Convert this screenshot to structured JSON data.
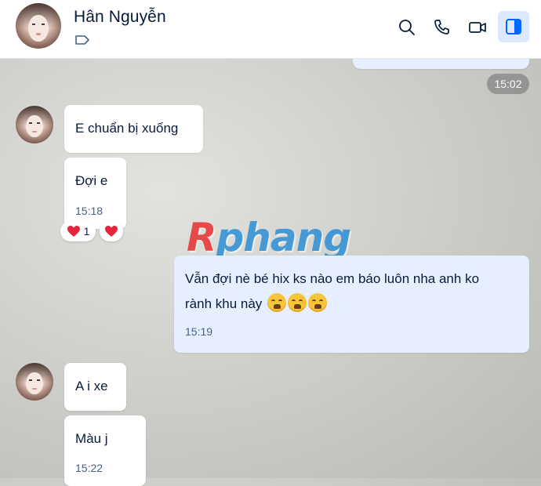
{
  "header": {
    "contact_name": "Hân Nguyễn",
    "icons": [
      "tag-icon",
      "search-icon",
      "phone-icon",
      "video-call-icon",
      "sidebar-toggle-icon"
    ]
  },
  "messages": {
    "time_chip": "15:02",
    "m1_text": "E chuẩn bị xuống",
    "m2_text": "Đợi e",
    "m2_time": "15:18",
    "m2_reaction_count": "1",
    "m3_line1": "Vẫn đợi nè bé hix ks nào em báo luôn nha anh ko",
    "m3_line2": "rành khu này",
    "m3_emojis": [
      "weary-face",
      "weary-face",
      "weary-face"
    ],
    "m3_time": "15:19",
    "m4_text": "A i xe",
    "m5_text": "Màu j",
    "m5_time": "15:22"
  },
  "watermark": {
    "first": "R",
    "rest": "phang"
  },
  "colors": {
    "accent": "#0068ff",
    "sent_bubble": "#e5efff",
    "heart": "#e5243b"
  }
}
